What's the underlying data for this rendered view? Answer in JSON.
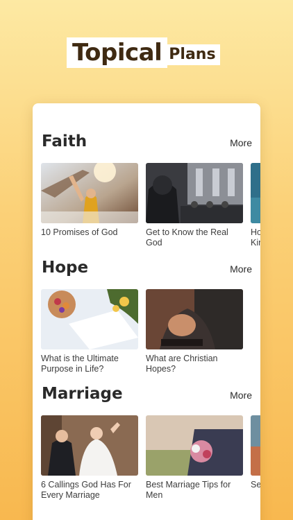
{
  "header": {
    "title_main": "Topical",
    "title_sub": "Plans"
  },
  "sections": [
    {
      "title": "Faith",
      "more_label": "More",
      "items": [
        {
          "caption": "10 Promises of God"
        },
        {
          "caption": "Get to Know the Real God"
        },
        {
          "caption": "How to Know the Kingdom"
        }
      ]
    },
    {
      "title": "Hope",
      "more_label": "More",
      "items": [
        {
          "caption": "What is the Ultimate Purpose in Life?"
        },
        {
          "caption": "What are Christian Hopes?"
        }
      ]
    },
    {
      "title": "Marriage",
      "more_label": "More",
      "items": [
        {
          "caption": "6 Callings God Has For Every Marriage"
        },
        {
          "caption": "Best Marriage Tips for Men"
        },
        {
          "caption": "Se"
        }
      ]
    }
  ],
  "colors": {
    "background_top": "#fde9a3",
    "background_bottom": "#f8b84f",
    "title_text": "#3f2a12"
  }
}
